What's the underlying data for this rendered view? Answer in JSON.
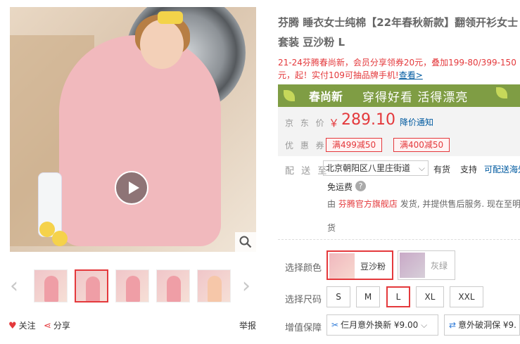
{
  "gallery": {
    "thumbnails": [
      "thumb-1",
      "thumb-2",
      "thumb-3",
      "thumb-4",
      "thumb-5"
    ],
    "selected_index": 1,
    "favorite_label": "关注",
    "share_label": "分享",
    "report_label": "举报"
  },
  "product": {
    "title": "芬腾 睡衣女士纯棉【22年春秋新款】翻领开衫女士套装 豆沙粉 L",
    "promo_text": "21-24芬腾春尚新，会员分享领券20元，叠加199-80/399-150元，起！实付109可抽品牌手机!",
    "promo_link": "查看>",
    "banner_logo": "春尚新",
    "banner_text": "穿得好看 活得漂亮"
  },
  "price": {
    "label": "京 东 价",
    "currency": "￥",
    "value": "289.10",
    "notify": "降价通知"
  },
  "coupons": {
    "label": "优 惠 券",
    "items": [
      "满499减50",
      "满400减50"
    ]
  },
  "shipping": {
    "label": "配 送 至",
    "address": "北京朝阳区八里庄街道",
    "stock": "有货",
    "support": "支持",
    "delivery": "可配送海外",
    "free_shipping": "免运费",
    "seller_prefix": "由",
    "seller_name": "芬腾官方旗舰店",
    "seller_suffix": "发货, 并提供售后服务. 现在至明",
    "seller_cont": "货"
  },
  "options": {
    "color_label": "选择颜色",
    "colors": [
      "豆沙粉",
      "灰绿"
    ],
    "selected_color": "豆沙粉",
    "size_label": "选择尺码",
    "sizes": [
      "S",
      "M",
      "L",
      "XL",
      "XXL"
    ],
    "selected_size": "L",
    "warranty_label": "增值保障",
    "warranties": [
      "仨月意外换新 ¥9.00",
      "意外破洞保 ¥9."
    ]
  },
  "colors": {
    "accent": "#e4393c",
    "link": "#005aa0",
    "banner": "#7f9d44"
  }
}
